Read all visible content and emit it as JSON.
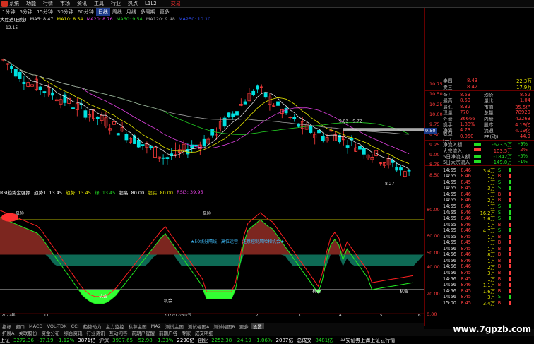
{
  "titlebar": {
    "menus": [
      "系统",
      "功能",
      "行情",
      "市场",
      "资讯",
      "工具",
      "行业",
      "热点",
      "L1L2"
    ],
    "brand": "交易"
  },
  "periods": [
    "1分钟",
    "5分钟",
    "15分钟",
    "30分钟",
    "60分钟",
    "日线",
    "周线",
    "月线",
    "多周期",
    "更多"
  ],
  "active_period": "日线",
  "ma": {
    "stock": "大胜达(日线)",
    "items": [
      {
        "label": "MA5: 8.47",
        "color": "#e0e0e0"
      },
      {
        "label": "MA10: 8.54",
        "color": "#e8e800"
      },
      {
        "label": "MA20: 8.76",
        "color": "#e040e0"
      },
      {
        "label": "MA60: 9.54",
        "color": "#22cc22"
      },
      {
        "label": "MA120: 9.48",
        "color": "#a0a0a0"
      },
      {
        "label": "MA250: 10.10",
        "color": "#3050ff"
      }
    ],
    "high_label": "12.15",
    "low_label": "8.27",
    "mid_label": "9.83 - 9.72",
    "current_price_tag": "9.50",
    "price_axis": [
      "10.75",
      "10.50",
      "10.25",
      "10.00",
      "9.75",
      "9.50",
      "9.25",
      "9.00",
      "8.75",
      "8.50"
    ]
  },
  "rsi": {
    "title": "RSI趋势定强择",
    "items": [
      {
        "label": "趋势1: 13.45",
        "color": "#ffffff"
      },
      {
        "label": "趋势: 13.45",
        "color": "#e8e800"
      },
      {
        "label": "绿: 13.45",
        "color": "#22dd22"
      },
      {
        "label": "超高: 80.00",
        "color": "#ffffff"
      },
      {
        "label": "超买: 80.00",
        "color": "#e8e800"
      },
      {
        "label": "RSI3: 39.95",
        "color": "#e040e0"
      }
    ],
    "annotations": {
      "risk": "风险",
      "chance": "机会",
      "note": "★50线分隔线，高位运营，注意控制风险和机会★"
    },
    "axis": [
      "80.00",
      "60.00",
      "50.00",
      "40.00",
      "20.00",
      "0.00"
    ],
    "date_labels": [
      "2022年",
      "11",
      "2022/12/30/五",
      "2",
      "3",
      "4",
      "5",
      "6"
    ]
  },
  "quotes": {
    "sells": [
      {
        "label": "卖四",
        "price": "8.43",
        "vol": "22.3万"
      },
      {
        "label": "卖三",
        "price": "8.42",
        "vol": "17.9万"
      }
    ],
    "stats": [
      {
        "l": "今开",
        "v": "8.53",
        "l2": "均价",
        "v2": "8.52"
      },
      {
        "l": "最高",
        "v": "8.59",
        "l2": "量比",
        "v2": "1.04"
      },
      {
        "l": "最低",
        "v": "8.32",
        "l2": "市值",
        "v2": "35.5亿"
      },
      {
        "l": "现量",
        "v": "770",
        "l2": "总量",
        "v2": "78929"
      },
      {
        "l": "外盘",
        "v": "36666",
        "l2": "内盘",
        "v2": "42263"
      },
      {
        "l": "换手",
        "v": "1.88%",
        "l2": "股本",
        "v2": "4.19亿"
      },
      {
        "l": "净资",
        "v": "4.73",
        "l2": "流通",
        "v2": "4.19亿"
      },
      {
        "l": "收益(一)",
        "v": "0.050",
        "l2": "PE(动)",
        "v2": "44.9"
      }
    ],
    "flows": [
      {
        "l": "净流入额",
        "v": "-623.5万",
        "p": "-9%"
      },
      {
        "l": "大宗流入",
        "v": "103.5万",
        "p": "2%"
      },
      {
        "l": "5日净流入额",
        "v": "-1842万",
        "p": "-5%"
      },
      {
        "l": "5日大宗流入",
        "v": "-149.0万",
        "p": "-1%"
      }
    ],
    "ticks": [
      {
        "t": "14:55",
        "p": "8.46",
        "v": "3.4万",
        "d": "S"
      },
      {
        "t": "14:55",
        "p": "8.46",
        "v": "1万",
        "d": "B"
      },
      {
        "t": "14:55",
        "p": "8.45",
        "v": "1万",
        "d": "S"
      },
      {
        "t": "14:55",
        "p": "8.45",
        "v": "3万",
        "d": "S"
      },
      {
        "t": "14:55",
        "p": "8.46",
        "v": "1万",
        "d": "B"
      },
      {
        "t": "14:55",
        "p": "8.46",
        "v": "2万",
        "d": "B"
      },
      {
        "t": "14:55",
        "p": "8.46",
        "v": "1万",
        "d": "S"
      },
      {
        "t": "14:55",
        "p": "8.46",
        "v": "16.2万",
        "d": "S"
      },
      {
        "t": "14:55",
        "p": "8.46",
        "v": "1.6万",
        "d": "S"
      },
      {
        "t": "14:55",
        "p": "8.46",
        "v": "1万",
        "d": "B"
      },
      {
        "t": "14:55",
        "p": "8.46",
        "v": "4.7万",
        "d": "S"
      },
      {
        "t": "14:55",
        "p": "8.45",
        "v": "1万",
        "d": "B"
      },
      {
        "t": "14:55",
        "p": "8.45",
        "v": "1万",
        "d": "B"
      },
      {
        "t": "14:56",
        "p": "8.45",
        "v": "1万",
        "d": "B"
      },
      {
        "t": "14:56",
        "p": "8.46",
        "v": "8万",
        "d": "B"
      },
      {
        "t": "14:56",
        "p": "8.46",
        "v": "1万",
        "d": "B"
      },
      {
        "t": "14:56",
        "p": "8.46",
        "v": "2万",
        "d": "B"
      },
      {
        "t": "14:56",
        "p": "8.45",
        "v": "3万",
        "d": "B"
      },
      {
        "t": "14:56",
        "p": "8.45",
        "v": "1万",
        "d": "B"
      },
      {
        "t": "14:56",
        "p": "8.46",
        "v": "1.1万",
        "d": "B"
      },
      {
        "t": "14:56",
        "p": "8.45",
        "v": "1.6万",
        "d": "B"
      },
      {
        "t": "14:56",
        "p": "8.45",
        "v": "3万",
        "d": "S"
      },
      {
        "t": "15:00",
        "p": "8.45",
        "v": "3.4万",
        "d": "B"
      }
    ]
  },
  "tabs": [
    "指标",
    "窗口",
    "MACD",
    "VOL-TDX",
    "CCI",
    "趋势动力",
    "主力监控",
    "私募主图",
    "MA2",
    "测试主图",
    "测试幅图A",
    "测试幅图B",
    "更多",
    "设置"
  ],
  "tabs_active": "设置",
  "tabs2": [
    "扩展A",
    "关联股份",
    "资金分布",
    "综合资讯",
    "行业资讯",
    "互动问答",
    "前期户提醒",
    "前期户名",
    "专家",
    "成交明细"
  ],
  "status": {
    "items": [
      {
        "name": "上证",
        "val": "3272.36",
        "chg": "-37.19",
        "pct": "-1.12%",
        "amt": "3871亿"
      },
      {
        "name": "沪深",
        "val": "3937.65",
        "chg": "-52.98",
        "pct": "-1.33%",
        "amt": "2290亿"
      },
      {
        "name": "创业",
        "val": "2252.38",
        "chg": "-24.19",
        "pct": "-1.06%",
        "amt": "2087亿"
      },
      {
        "name": "总成交",
        "val": "8481亿",
        "chg": "",
        "pct": "",
        "amt": ""
      }
    ],
    "broker": "平安证券上海上证云行情",
    "site": "www.7gpzb.com"
  },
  "colors": {
    "up": "#ff3b3b",
    "down": "#22dd22",
    "bg": "#000000"
  }
}
